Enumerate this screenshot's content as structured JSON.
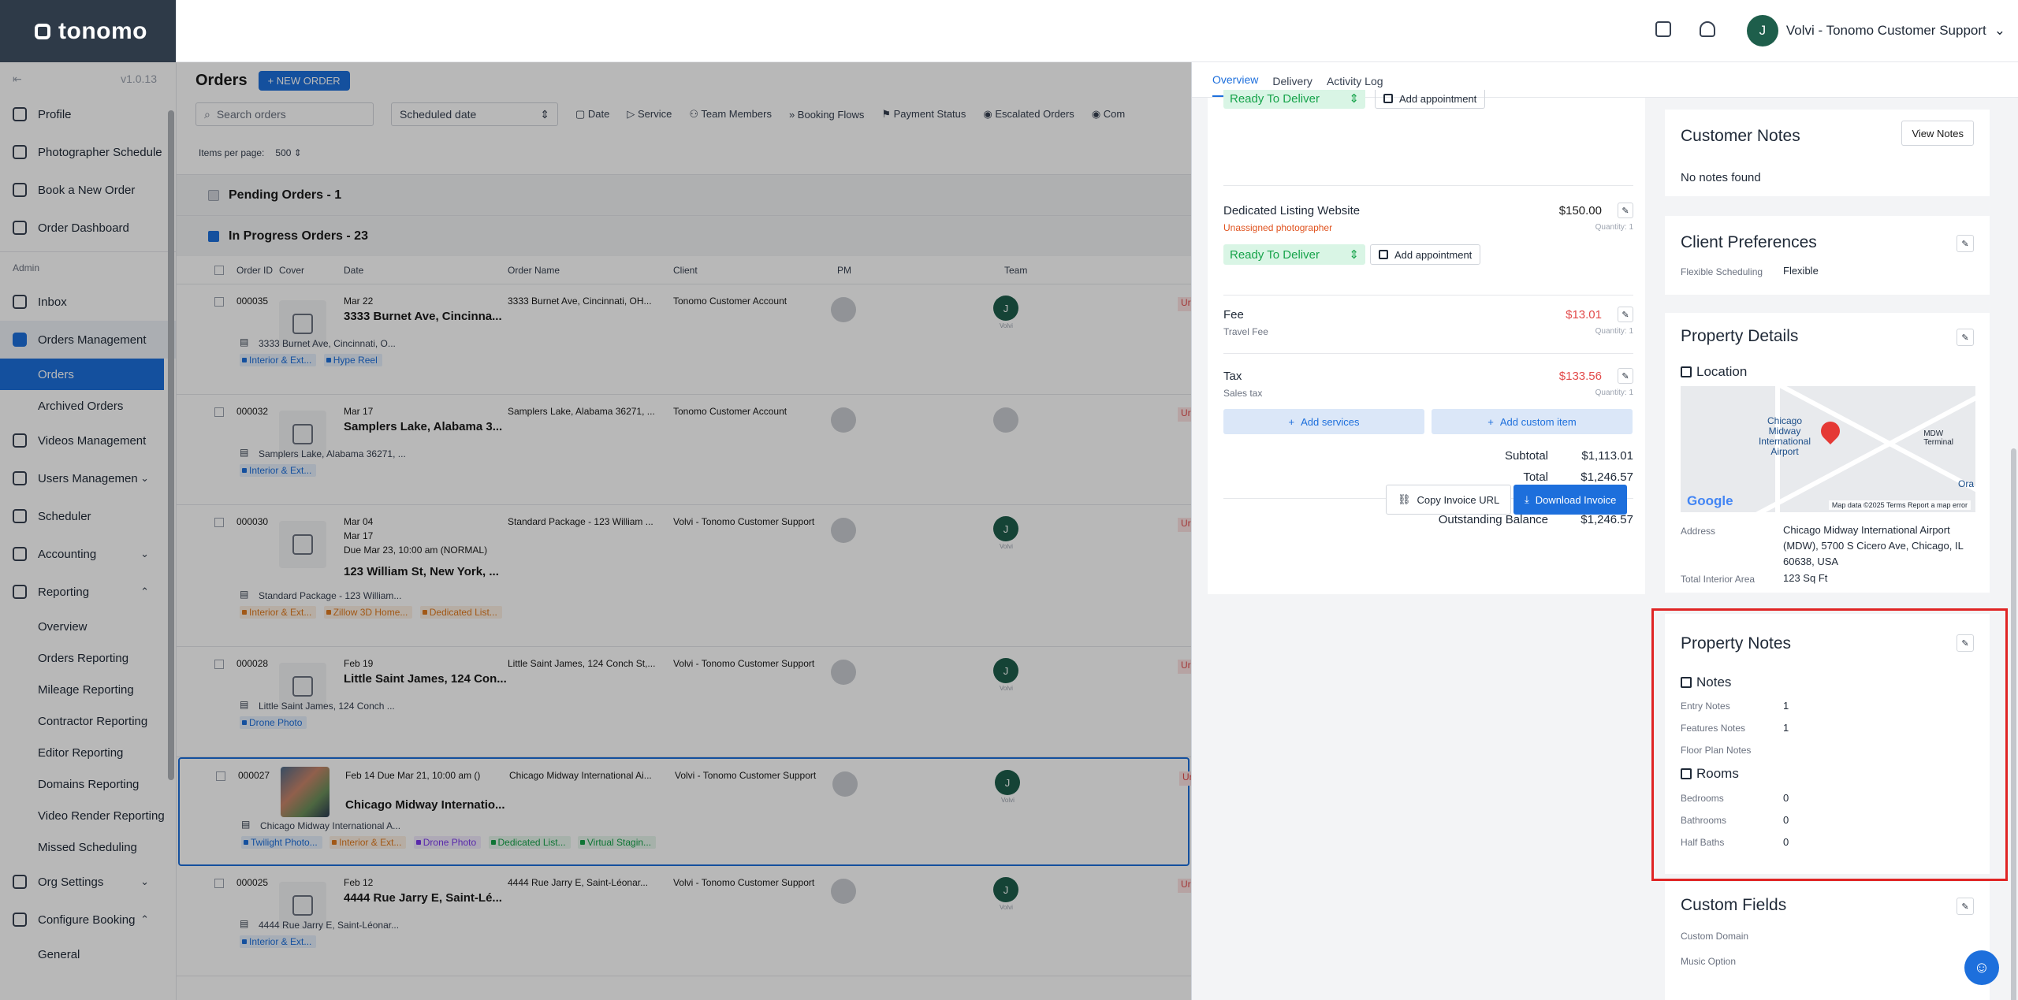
{
  "app": {
    "logo": "tonomo",
    "version": "v1.0.13"
  },
  "header": {
    "user_initial": "J",
    "user_name": "Volvi - Tonomo Customer Support"
  },
  "sidebar": {
    "items": [
      {
        "label": "Profile"
      },
      {
        "label": "Photographer Schedule"
      },
      {
        "label": "Book a New Order"
      },
      {
        "label": "Order Dashboard"
      }
    ],
    "admin_label": "Admin",
    "admin_items": [
      {
        "label": "Inbox"
      },
      {
        "label": "Orders Management"
      },
      {
        "label": "Videos Management"
      },
      {
        "label": "Users Managemen"
      },
      {
        "label": "Scheduler"
      },
      {
        "label": "Accounting"
      },
      {
        "label": "Reporting"
      },
      {
        "label": "Org Settings"
      },
      {
        "label": "Configure Booking"
      }
    ],
    "orders_sub": [
      "Orders",
      "Archived Orders"
    ],
    "reporting_sub": [
      "Overview",
      "Orders Reporting",
      "Mileage Reporting",
      "Contractor Reporting",
      "Editor Reporting",
      "Domains Reporting",
      "Video Render Reporting",
      "Missed Scheduling"
    ],
    "config_sub": [
      "General"
    ]
  },
  "orders": {
    "title": "Orders",
    "new_order": "+ NEW ORDER",
    "search_placeholder": "Search orders",
    "sort_select": "Scheduled date",
    "filters": [
      "Date",
      "Service",
      "Team Members",
      "Booking Flows",
      "Payment Status",
      "Escalated Orders",
      "Com"
    ],
    "per_page_label": "Items per page:",
    "per_page_value": "500",
    "groups": {
      "pending": "Pending Orders - 1",
      "in_progress": "In Progress Orders - 23"
    },
    "columns": {
      "id": "Order ID",
      "cover": "Cover",
      "date": "Date",
      "name": "Order Name",
      "client": "Client",
      "pm": "PM",
      "team": "Team"
    },
    "rows": [
      {
        "id": "000035",
        "date": "Mar 22",
        "title": "3333 Burnet Ave, Cincinna...",
        "name": "3333 Burnet Ave, Cincinnati, OH...",
        "client": "Tonomo Customer Account",
        "addr": "3333 Burnet Ave, Cincinnati, O...",
        "team": "J",
        "status": "Ur"
      },
      {
        "id": "000032",
        "date": "Mar 17",
        "title": "Samplers Lake, Alabama 3...",
        "name": "Samplers Lake, Alabama 36271, ...",
        "client": "Tonomo Customer Account",
        "addr": "Samplers Lake, Alabama 36271, ...",
        "team": "",
        "status": "Ur"
      },
      {
        "id": "000030",
        "date": "Mar 04",
        "date2": "Mar 17",
        "due": "Due Mar 23, 10:00 am (NORMAL)",
        "title": "123 William St, New York, ...",
        "name": "Standard Package - 123 William ...",
        "client": "Volvi - Tonomo Customer Support",
        "addr": "Standard Package - 123 William...",
        "team": "J",
        "status": "Ur"
      },
      {
        "id": "000028",
        "date": "Feb 19",
        "title": "Little Saint James, 124 Con...",
        "name": "Little Saint James, 124 Conch St,...",
        "client": "Volvi - Tonomo Customer Support",
        "addr": "Little Saint James, 124 Conch ...",
        "team": "J",
        "status": "Ur"
      },
      {
        "id": "000027",
        "date": "Feb 14 Due Mar 21, 10:00 am ()",
        "title": "Chicago Midway Internatio...",
        "name": "Chicago Midway International Ai...",
        "client": "Volvi - Tonomo Customer Support",
        "addr": "Chicago Midway International A...",
        "team": "J",
        "status": "Ur"
      },
      {
        "id": "000025",
        "date": "Feb 12",
        "title": "4444 Rue Jarry E, Saint-Lé...",
        "name": "4444 Rue Jarry E, Saint-Léonar...",
        "client": "Volvi - Tonomo Customer Support",
        "addr": "4444 Rue Jarry E, Saint-Léonar...",
        "team": "J",
        "status": "Ur"
      }
    ],
    "tags": {
      "r0": [
        "Interior & Ext...",
        "Hype Reel"
      ],
      "r1": [
        "Interior & Ext..."
      ],
      "r2": [
        "Interior & Ext...",
        "Zillow 3D Home...",
        "Dedicated List..."
      ],
      "r3": [
        "Drone Photo"
      ],
      "r4": [
        "Twilight Photo...",
        "Interior & Ext...",
        "Drone Photo",
        "Dedicated List...",
        "Virtual Stagin..."
      ],
      "r5": [
        "Interior & Ext..."
      ]
    },
    "team_sub": "Volvi"
  },
  "drawer": {
    "tabs": [
      "Overview",
      "Delivery",
      "Activity Log"
    ],
    "invoice": {
      "top_status": "Ready To Deliver",
      "top_appt": "Add appointment",
      "items": [
        {
          "name": "Dedicated Listing Website",
          "sub": "Unassigned photographer",
          "price": "$150.00",
          "qty": "Quantity: 1",
          "status": "Ready To Deliver",
          "appt": "Add appointment"
        },
        {
          "name": "Fee",
          "sub": "Travel Fee",
          "price": "$13.01",
          "qty": "Quantity: 1"
        },
        {
          "name": "Tax",
          "sub": "Sales tax",
          "price": "$133.56",
          "qty": "Quantity: 1"
        }
      ],
      "add_services": "Add services",
      "add_custom": "Add custom item",
      "subtotal_label": "Subtotal",
      "subtotal": "$1,113.01",
      "total_label": "Total",
      "total": "$1,246.57",
      "balance_label": "Outstanding Balance",
      "balance": "$1,246.57",
      "copy_url": "Copy Invoice URL",
      "download": "Download Invoice"
    },
    "customer_notes": {
      "title": "Customer Notes",
      "view_btn": "View Notes",
      "empty": "No notes found"
    },
    "client_prefs": {
      "title": "Client Preferences",
      "key": "Flexible Scheduling",
      "value": "Flexible"
    },
    "property_details": {
      "title": "Property Details",
      "location": "Location",
      "map_label": "Chicago\nMidway\nInternational\nAirport",
      "map_terminal": "MDW\nTerminal",
      "map_ora": "Ora",
      "map_brand": "Google",
      "map_data": "Map data ©2025",
      "map_terms": "Terms",
      "map_report": "Report a map error",
      "address_label": "Address",
      "address": "Chicago Midway International Airport (MDW), 5700 S Cicero Ave, Chicago, IL 60638, USA",
      "area_label": "Total Interior Area",
      "area": "123 Sq Ft"
    },
    "property_notes": {
      "title": "Property Notes",
      "notes_h": "Notes",
      "entry_label": "Entry Notes",
      "entry": "1",
      "features_label": "Features Notes",
      "features": "1",
      "floor_label": "Floor Plan Notes",
      "rooms_h": "Rooms",
      "bedrooms_label": "Bedrooms",
      "bedrooms": "0",
      "bathrooms_label": "Bathrooms",
      "bathrooms": "0",
      "half_label": "Half Baths",
      "half": "0"
    },
    "custom_fields": {
      "title": "Custom Fields",
      "domain_label": "Custom Domain",
      "music_label": "Music Option"
    }
  },
  "colors": {
    "accent": "#1d6fdc",
    "header_dark": "#2e3a48",
    "highlight": "#e02424",
    "ready_green": "#16a34a",
    "price_red": "#e24b4b"
  }
}
